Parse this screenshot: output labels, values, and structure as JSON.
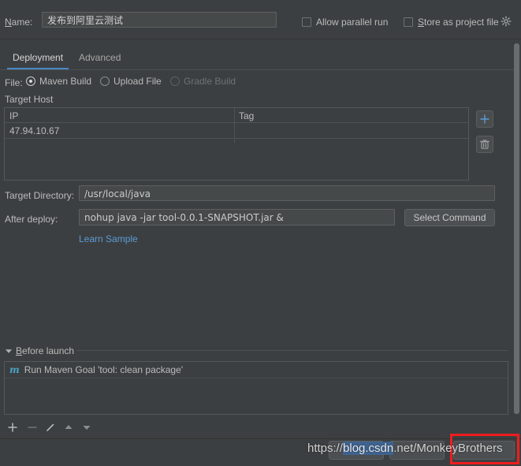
{
  "header": {
    "name_label": "Name:",
    "name_value": "发布到阿里云测试",
    "allow_parallel_run": "Allow parallel run",
    "store_as_project_file": "Store as project file",
    "gear_icon": "gear-icon"
  },
  "tabs": [
    {
      "label": "Deployment",
      "active": true
    },
    {
      "label": "Advanced",
      "active": false
    }
  ],
  "file_row": {
    "label": "File:",
    "options": [
      {
        "label": "Maven Build",
        "selected": true,
        "disabled": false
      },
      {
        "label": "Upload File",
        "selected": false,
        "disabled": false
      },
      {
        "label": "Gradle Build",
        "selected": false,
        "disabled": true
      }
    ]
  },
  "target_host": {
    "section_label": "Target Host",
    "columns": [
      "IP",
      "Tag"
    ],
    "rows": [
      {
        "ip": "47.94.10.67",
        "tag": ""
      }
    ],
    "add_icon": "plus-icon",
    "remove_icon": "trash-icon"
  },
  "target_directory": {
    "label": "Target Directory:",
    "value": "/usr/local/java"
  },
  "after_deploy": {
    "label": "After deploy:",
    "value": "nohup java -jar tool-0.0.1-SNAPSHOT.jar &",
    "select_command_button": "Select Command",
    "learn_sample_link": "Learn Sample"
  },
  "before_launch": {
    "label": "Before launch",
    "collapse_icon": "triangle-down-icon",
    "items": [
      {
        "icon": "maven-icon",
        "icon_glyph": "m",
        "text": "Run Maven Goal 'tool: clean package'"
      }
    ],
    "toolbar": [
      {
        "name": "add",
        "glyph": "+"
      },
      {
        "name": "remove",
        "glyph": "−"
      },
      {
        "name": "edit",
        "glyph": "pencil"
      },
      {
        "name": "move-up",
        "glyph": "▲"
      },
      {
        "name": "move-down",
        "glyph": "▼"
      }
    ]
  },
  "watermark": {
    "prefix": "https://",
    "highlight": "blog.csdn",
    "suffix": ".net/MonkeyBrothers"
  },
  "colors": {
    "background": "#3c3f41",
    "accent_blue": "#4a88c7",
    "link_blue": "#5b9bd5",
    "maven_icon": "#4aa3c8",
    "highlight_red": "#ef1d1d",
    "field_background": "#45494a"
  }
}
